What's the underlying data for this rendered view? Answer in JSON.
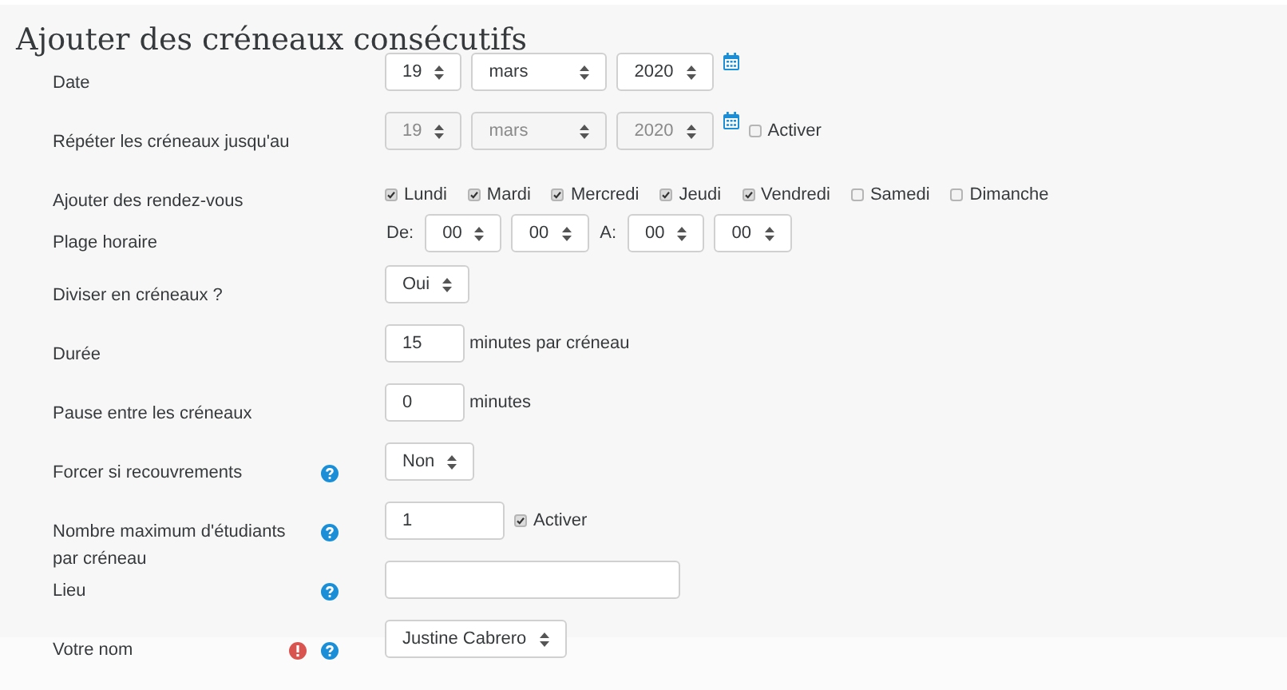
{
  "title": "Ajouter des créneaux consécutifs",
  "rows": [
    {
      "kind": "date",
      "label": "Date",
      "help": false,
      "required": false,
      "controls": [
        {
          "kind": "select",
          "value": "19",
          "disabled": false
        },
        {
          "kind": "select",
          "value": "mars",
          "disabled": false
        },
        {
          "kind": "select",
          "value": "2020",
          "disabled": false
        },
        {
          "kind": "calendar"
        }
      ]
    },
    {
      "kind": "date",
      "label": "Répéter les créneaux jusqu'au",
      "help": false,
      "required": false,
      "controls": [
        {
          "kind": "select",
          "value": "19",
          "disabled": true
        },
        {
          "kind": "select",
          "value": "mars",
          "disabled": true
        },
        {
          "kind": "select",
          "value": "2020",
          "disabled": true
        },
        {
          "kind": "calendar"
        },
        {
          "kind": "checkbox",
          "label": "Activer",
          "checked": false
        }
      ]
    },
    {
      "kind": "days",
      "label": "Ajouter des rendez-vous",
      "help": false,
      "required": false,
      "controls": [
        {
          "kind": "checkbox",
          "label": "Lundi",
          "checked": true
        },
        {
          "kind": "checkbox",
          "label": "Mardi",
          "checked": true
        },
        {
          "kind": "checkbox",
          "label": "Mercredi",
          "checked": true
        },
        {
          "kind": "checkbox",
          "label": "Jeudi",
          "checked": true
        },
        {
          "kind": "checkbox",
          "label": "Vendredi",
          "checked": true
        },
        {
          "kind": "checkbox",
          "label": "Samedi",
          "checked": false
        },
        {
          "kind": "checkbox",
          "label": "Dimanche",
          "checked": false
        }
      ]
    },
    {
      "kind": "time",
      "label": "Plage horaire",
      "help": false,
      "required": false,
      "controls": [
        {
          "kind": "label",
          "text": "De:"
        },
        {
          "kind": "select",
          "value": "00",
          "disabled": false
        },
        {
          "kind": "select",
          "value": "00",
          "disabled": false
        },
        {
          "kind": "label",
          "text": "A:"
        },
        {
          "kind": "select",
          "value": "00",
          "disabled": false
        },
        {
          "kind": "select",
          "value": "00",
          "disabled": false
        }
      ]
    },
    {
      "kind": "field",
      "label": "Diviser en créneaux ?",
      "help": false,
      "required": false,
      "controls": [
        {
          "kind": "select",
          "value": "Oui",
          "disabled": false
        }
      ]
    },
    {
      "kind": "field",
      "label": "Durée",
      "help": false,
      "required": false,
      "controls": [
        {
          "kind": "input",
          "value": "15"
        },
        {
          "kind": "unit",
          "text": "minutes par créneau"
        }
      ]
    },
    {
      "kind": "field",
      "label": "Pause entre les créneaux",
      "help": false,
      "required": false,
      "controls": [
        {
          "kind": "input",
          "value": "0"
        },
        {
          "kind": "unit",
          "text": "minutes"
        }
      ]
    },
    {
      "kind": "field",
      "label": "Forcer si recouvrements",
      "help": true,
      "required": false,
      "controls": [
        {
          "kind": "select",
          "value": "Non",
          "disabled": false
        }
      ]
    },
    {
      "kind": "field",
      "label": "Nombre maximum d'étudiants par créneau",
      "help": true,
      "required": false,
      "controls": [
        {
          "kind": "input",
          "value": "1"
        },
        {
          "kind": "checkbox",
          "label": "Activer",
          "checked": true
        }
      ]
    },
    {
      "kind": "field",
      "label": "Lieu",
      "help": true,
      "required": false,
      "controls": [
        {
          "kind": "input"
        }
      ]
    },
    {
      "kind": "field",
      "label": "Votre nom",
      "help": true,
      "required": true,
      "controls": [
        {
          "kind": "select",
          "value": "Justine Cabrero",
          "disabled": false
        }
      ]
    }
  ]
}
